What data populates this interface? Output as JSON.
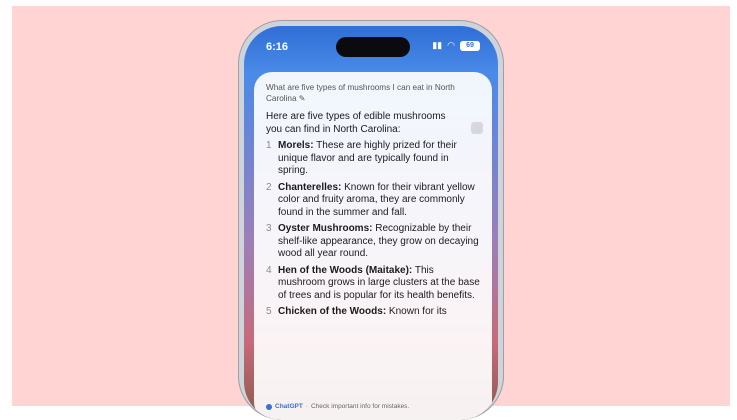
{
  "status_bar": {
    "time": "6:16",
    "battery": "69"
  },
  "chat": {
    "query": "What are five types of mushrooms I can eat in North Carolina",
    "answer_intro": "Here are five types of edible mushrooms you can find in North Carolina:",
    "items": [
      {
        "number": "1",
        "title": "Morels:",
        "text": " These are highly prized for their unique flavor and are typically found in spring."
      },
      {
        "number": "2",
        "title": "Chanterelles:",
        "text": " Known for their vibrant yellow color and fruity aroma, they are commonly found in the summer and fall."
      },
      {
        "number": "3",
        "title": "Oyster Mushrooms:",
        "text": " Recognizable by their shelf-like appearance, they grow on decaying wood all year round."
      },
      {
        "number": "4",
        "title": "Hen of the Woods (Maitake):",
        "text": " This mushroom grows in large clusters at the base of trees and is popular for its health benefits."
      },
      {
        "number": "5",
        "title": "Chicken of the Woods:",
        "text": " Known for its"
      }
    ],
    "footer_brand": "ChatGPT",
    "footer_text": "Check important info for mistakes."
  }
}
